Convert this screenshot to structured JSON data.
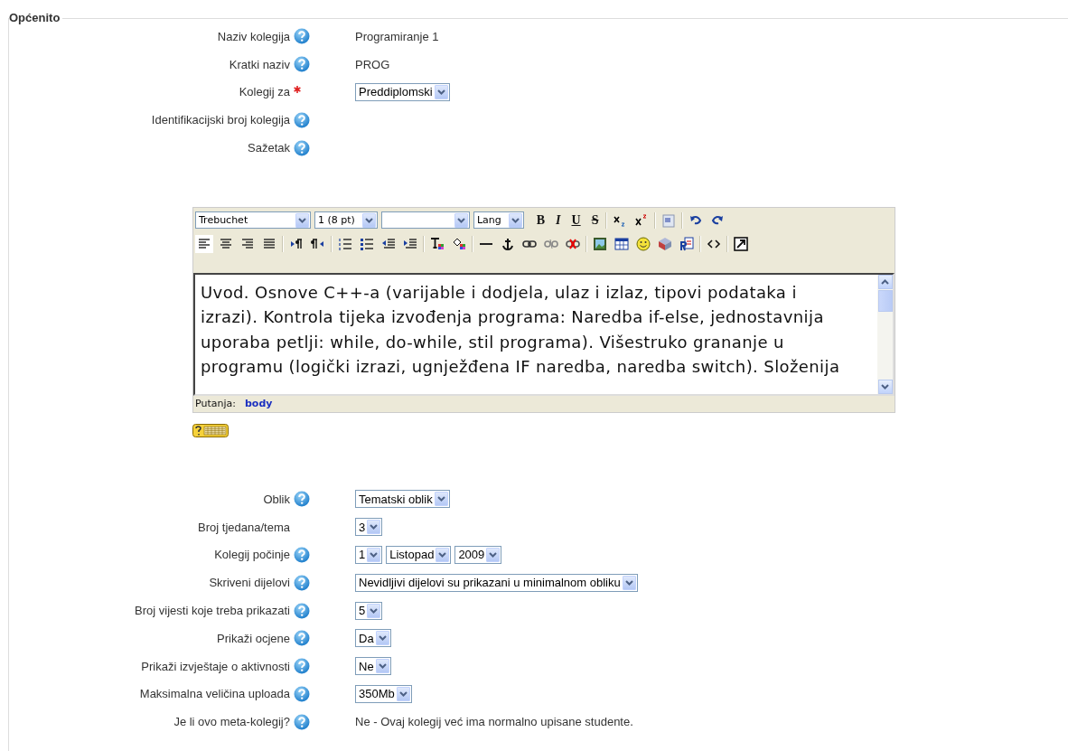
{
  "section": {
    "legend": "Općenito"
  },
  "fields_top": [
    {
      "label": "Naziv kolegija",
      "help": true,
      "required": false,
      "kind": "text",
      "value": "Programiranje 1"
    },
    {
      "label": "Kratki naziv",
      "help": true,
      "required": false,
      "kind": "text",
      "value": "PROG"
    },
    {
      "label": "Kolegij za",
      "help": false,
      "required": true,
      "kind": "select",
      "selects": [
        "Preddiplomski"
      ]
    },
    {
      "label": "Identifikacijski broj kolegija",
      "help": true,
      "required": false,
      "kind": "empty"
    },
    {
      "label": "Sažetak",
      "help": true,
      "required": false,
      "kind": "empty"
    }
  ],
  "editor": {
    "font_select": "Trebuchet",
    "size_select": "1 (8 pt)",
    "lang_select": "Lang",
    "format_buttons": [
      "B",
      "I",
      "U",
      "S"
    ],
    "text_lines": [
      "Uvod. Osnove C++-a (varijable i dodjela, ulaz i izlaz, tipovi podataka i",
      "izrazi). Kontrola tijeka izvođenja programa: Naredba if-else, jednostavnija",
      "uporaba petlji: while, do-while, stil programa). Višestruko grananje u",
      "programu (logički izrazi, ugnježđena IF naredba, naredba switch). Složenija"
    ],
    "path_label": "Putanja:",
    "path_value": "body"
  },
  "fields_bottom": [
    {
      "label": "Oblik",
      "help": true,
      "required": false,
      "kind": "select",
      "selects": [
        "Tematski oblik"
      ]
    },
    {
      "label": "Broj tjedana/tema",
      "help": false,
      "required": false,
      "kind": "select",
      "selects": [
        "3"
      ]
    },
    {
      "label": "Kolegij počinje",
      "help": true,
      "required": false,
      "kind": "select",
      "selects": [
        "1",
        "Listopad",
        "2009"
      ]
    },
    {
      "label": "Skriveni dijelovi",
      "help": true,
      "required": false,
      "kind": "select",
      "selects": [
        "Nevidljivi dijelovi su prikazani u minimalnom obliku"
      ]
    },
    {
      "label": "Broj vijesti koje treba prikazati",
      "help": true,
      "required": false,
      "kind": "select",
      "selects": [
        "5"
      ]
    },
    {
      "label": "Prikaži ocjene",
      "help": true,
      "required": false,
      "kind": "select",
      "selects": [
        "Da"
      ]
    },
    {
      "label": "Prikaži izvještaje o aktivnosti",
      "help": true,
      "required": false,
      "kind": "select",
      "selects": [
        "Ne"
      ]
    },
    {
      "label": "Maksimalna veličina uploada",
      "help": true,
      "required": false,
      "kind": "select",
      "selects": [
        "350Mb"
      ]
    },
    {
      "label": "Je li ovo meta-kolegij?",
      "help": true,
      "required": false,
      "kind": "text",
      "value": "Ne - Ovaj kolegij već ima normalno upisane studente."
    }
  ]
}
